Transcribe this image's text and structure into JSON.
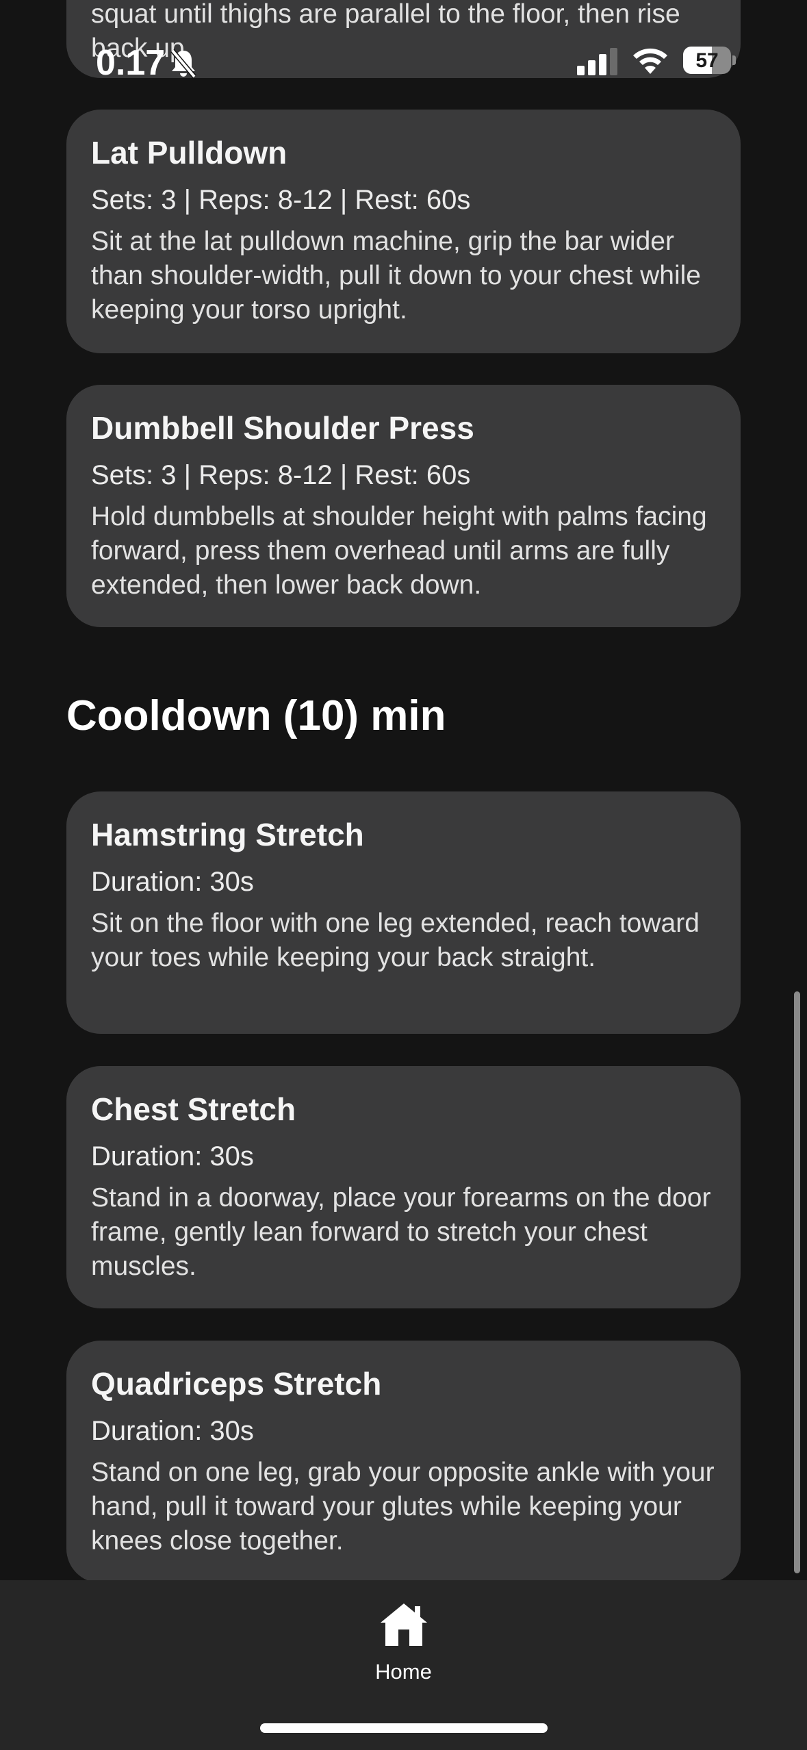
{
  "top_partial_card": {
    "description": "squat until thighs are parallel to the floor, then rise back up."
  },
  "status_bar": {
    "time": "0.17",
    "battery": "57"
  },
  "main_exercises": [
    {
      "name": "Lat Pulldown",
      "meta": "Sets: 3 | Reps: 8-12 | Rest: 60s",
      "description": "Sit at the lat pulldown machine, grip the bar wider than shoulder-width, pull it down to your chest while keeping your torso upright."
    },
    {
      "name": "Dumbbell Shoulder Press",
      "meta": "Sets: 3 | Reps: 8-12 | Rest: 60s",
      "description": "Hold dumbbells at shoulder height with palms facing forward, press them overhead until arms are fully extended, then lower back down."
    }
  ],
  "cooldown": {
    "title": "Cooldown (10) min",
    "exercises": [
      {
        "name": "Hamstring Stretch",
        "meta": "Duration: 30s",
        "description": "Sit on the floor with one leg extended, reach toward your toes while keeping your back straight."
      },
      {
        "name": "Chest Stretch",
        "meta": "Duration: 30s",
        "description": "Stand in a doorway, place your forearms on the door frame, gently lean forward to stretch your chest muscles."
      },
      {
        "name": "Quadriceps Stretch",
        "meta": "Duration: 30s",
        "description": "Stand on one leg, grab your opposite ankle with your hand, pull it toward your glutes while keeping your knees close together."
      }
    ]
  },
  "tab_bar": {
    "home_label": "Home",
    "home_icon": "house-icon"
  },
  "colors": {
    "background": "#141414",
    "card": "#3a3a3b",
    "tab_bar": "#262626"
  }
}
